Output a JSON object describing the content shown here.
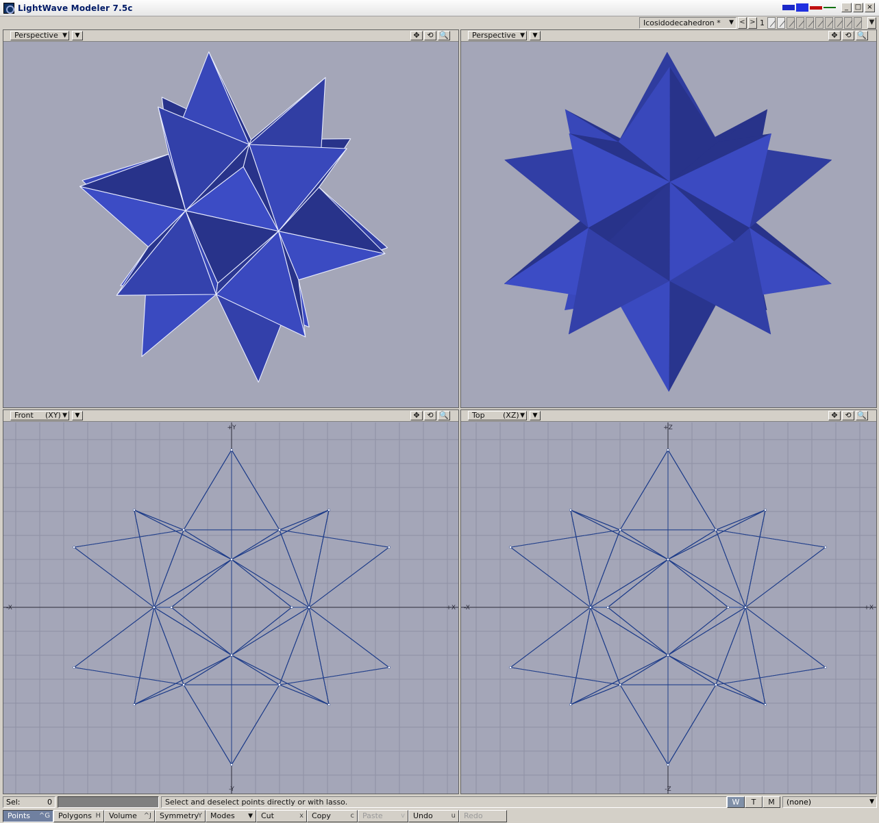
{
  "window": {
    "title": "LightWave Modeler 7.5c",
    "min": "_",
    "max": "□",
    "close": "×"
  },
  "colors": {
    "viewport_bg": "#a4a6b8",
    "solid_light": "#3d4cc0",
    "solid_mid": "#2c3a9e",
    "solid_dark": "#1d2670",
    "wire": "#1f3d8a",
    "grid": "#8e90a4",
    "axis": "#2a2a38"
  },
  "topbar": {
    "object": "Icosidodecahedron *",
    "prev": "<",
    "next": ">",
    "layer": "1"
  },
  "viewports": [
    {
      "name": "Perspective",
      "axis": "",
      "style": "sketch-shaded"
    },
    {
      "name": "Perspective",
      "axis": "",
      "style": "smooth-shaded"
    },
    {
      "name": "Front",
      "axis": "(XY)",
      "style": "wireframe",
      "labels": {
        "top": "+Y",
        "bottom": "-Y",
        "left": "-X",
        "right": "+X"
      }
    },
    {
      "name": "Top",
      "axis": "(XZ)",
      "style": "wireframe",
      "labels": {
        "top": "+Z",
        "bottom": "-Z",
        "left": "-X",
        "right": "+X"
      }
    }
  ],
  "viewport_tools": {
    "move": "✥",
    "rotate": "⟲",
    "zoom": "🔍"
  },
  "status": {
    "sel_label": "Sel:",
    "sel_count": "0",
    "hint": "Select and deselect points directly or with lasso.",
    "w": "W",
    "t": "T",
    "m": "M",
    "surface": "(none)"
  },
  "modes": [
    {
      "label": "Points",
      "key": "^G",
      "state": "on"
    },
    {
      "label": "Polygons",
      "key": "H",
      "state": ""
    },
    {
      "label": "Volume",
      "key": "^J",
      "state": ""
    },
    {
      "label": "Symmetry",
      "key": "Y",
      "state": ""
    },
    {
      "label": "Modes",
      "key": "",
      "state": "",
      "dropdown": true
    },
    {
      "label": "Cut",
      "key": "x",
      "state": ""
    },
    {
      "label": "Copy",
      "key": "c",
      "state": ""
    },
    {
      "label": "Paste",
      "key": "v",
      "state": "dis"
    },
    {
      "label": "Undo",
      "key": "u",
      "state": ""
    },
    {
      "label": "Redo",
      "key": "",
      "state": "dis"
    }
  ]
}
